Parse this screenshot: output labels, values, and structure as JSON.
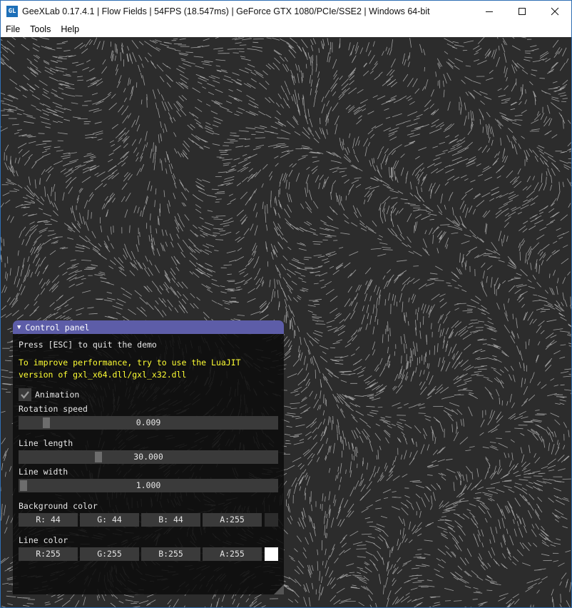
{
  "window": {
    "title": "GeeXLab 0.17.4.1 | Flow Fields | 54FPS (18.547ms) | GeForce GTX 1080/PCIe/SSE2 | Windows 64-bit",
    "app_icon_text": "GL",
    "controls": {
      "minimize": "minimize-icon",
      "maximize": "maximize-icon",
      "close": "close-icon"
    }
  },
  "menu": {
    "items": [
      {
        "label": "File"
      },
      {
        "label": "Tools"
      },
      {
        "label": "Help"
      }
    ]
  },
  "canvas": {
    "background_color": "#2c2c2c",
    "line_color": "#ffffff"
  },
  "panel": {
    "title": "Control panel",
    "quit_text": "Press [ESC] to quit the demo",
    "perf_line1": "To improve performance, try to use the LuaJIT",
    "perf_line2": "version of gxl_x64.dll/gxl_x32.dll",
    "animation": {
      "label": "Animation",
      "checked": true
    },
    "rotation_speed": {
      "label": "Rotation speed",
      "value": "0.009",
      "fraction": 0.09
    },
    "line_length": {
      "label": "Line length",
      "value": "30.000",
      "fraction": 0.3
    },
    "line_width": {
      "label": "Line width",
      "value": "1.000",
      "fraction": 0.0
    },
    "background_color": {
      "label": "Background color",
      "r": "R: 44",
      "g": "G: 44",
      "b": "B: 44",
      "a": "A:255",
      "swatch": "#2c2c2c"
    },
    "line_color": {
      "label": "Line color",
      "r": "R:255",
      "g": "G:255",
      "b": "B:255",
      "a": "A:255",
      "swatch": "#ffffff"
    },
    "colors": {
      "header": "#5d5da8",
      "warning_text": "#ffff33"
    }
  }
}
